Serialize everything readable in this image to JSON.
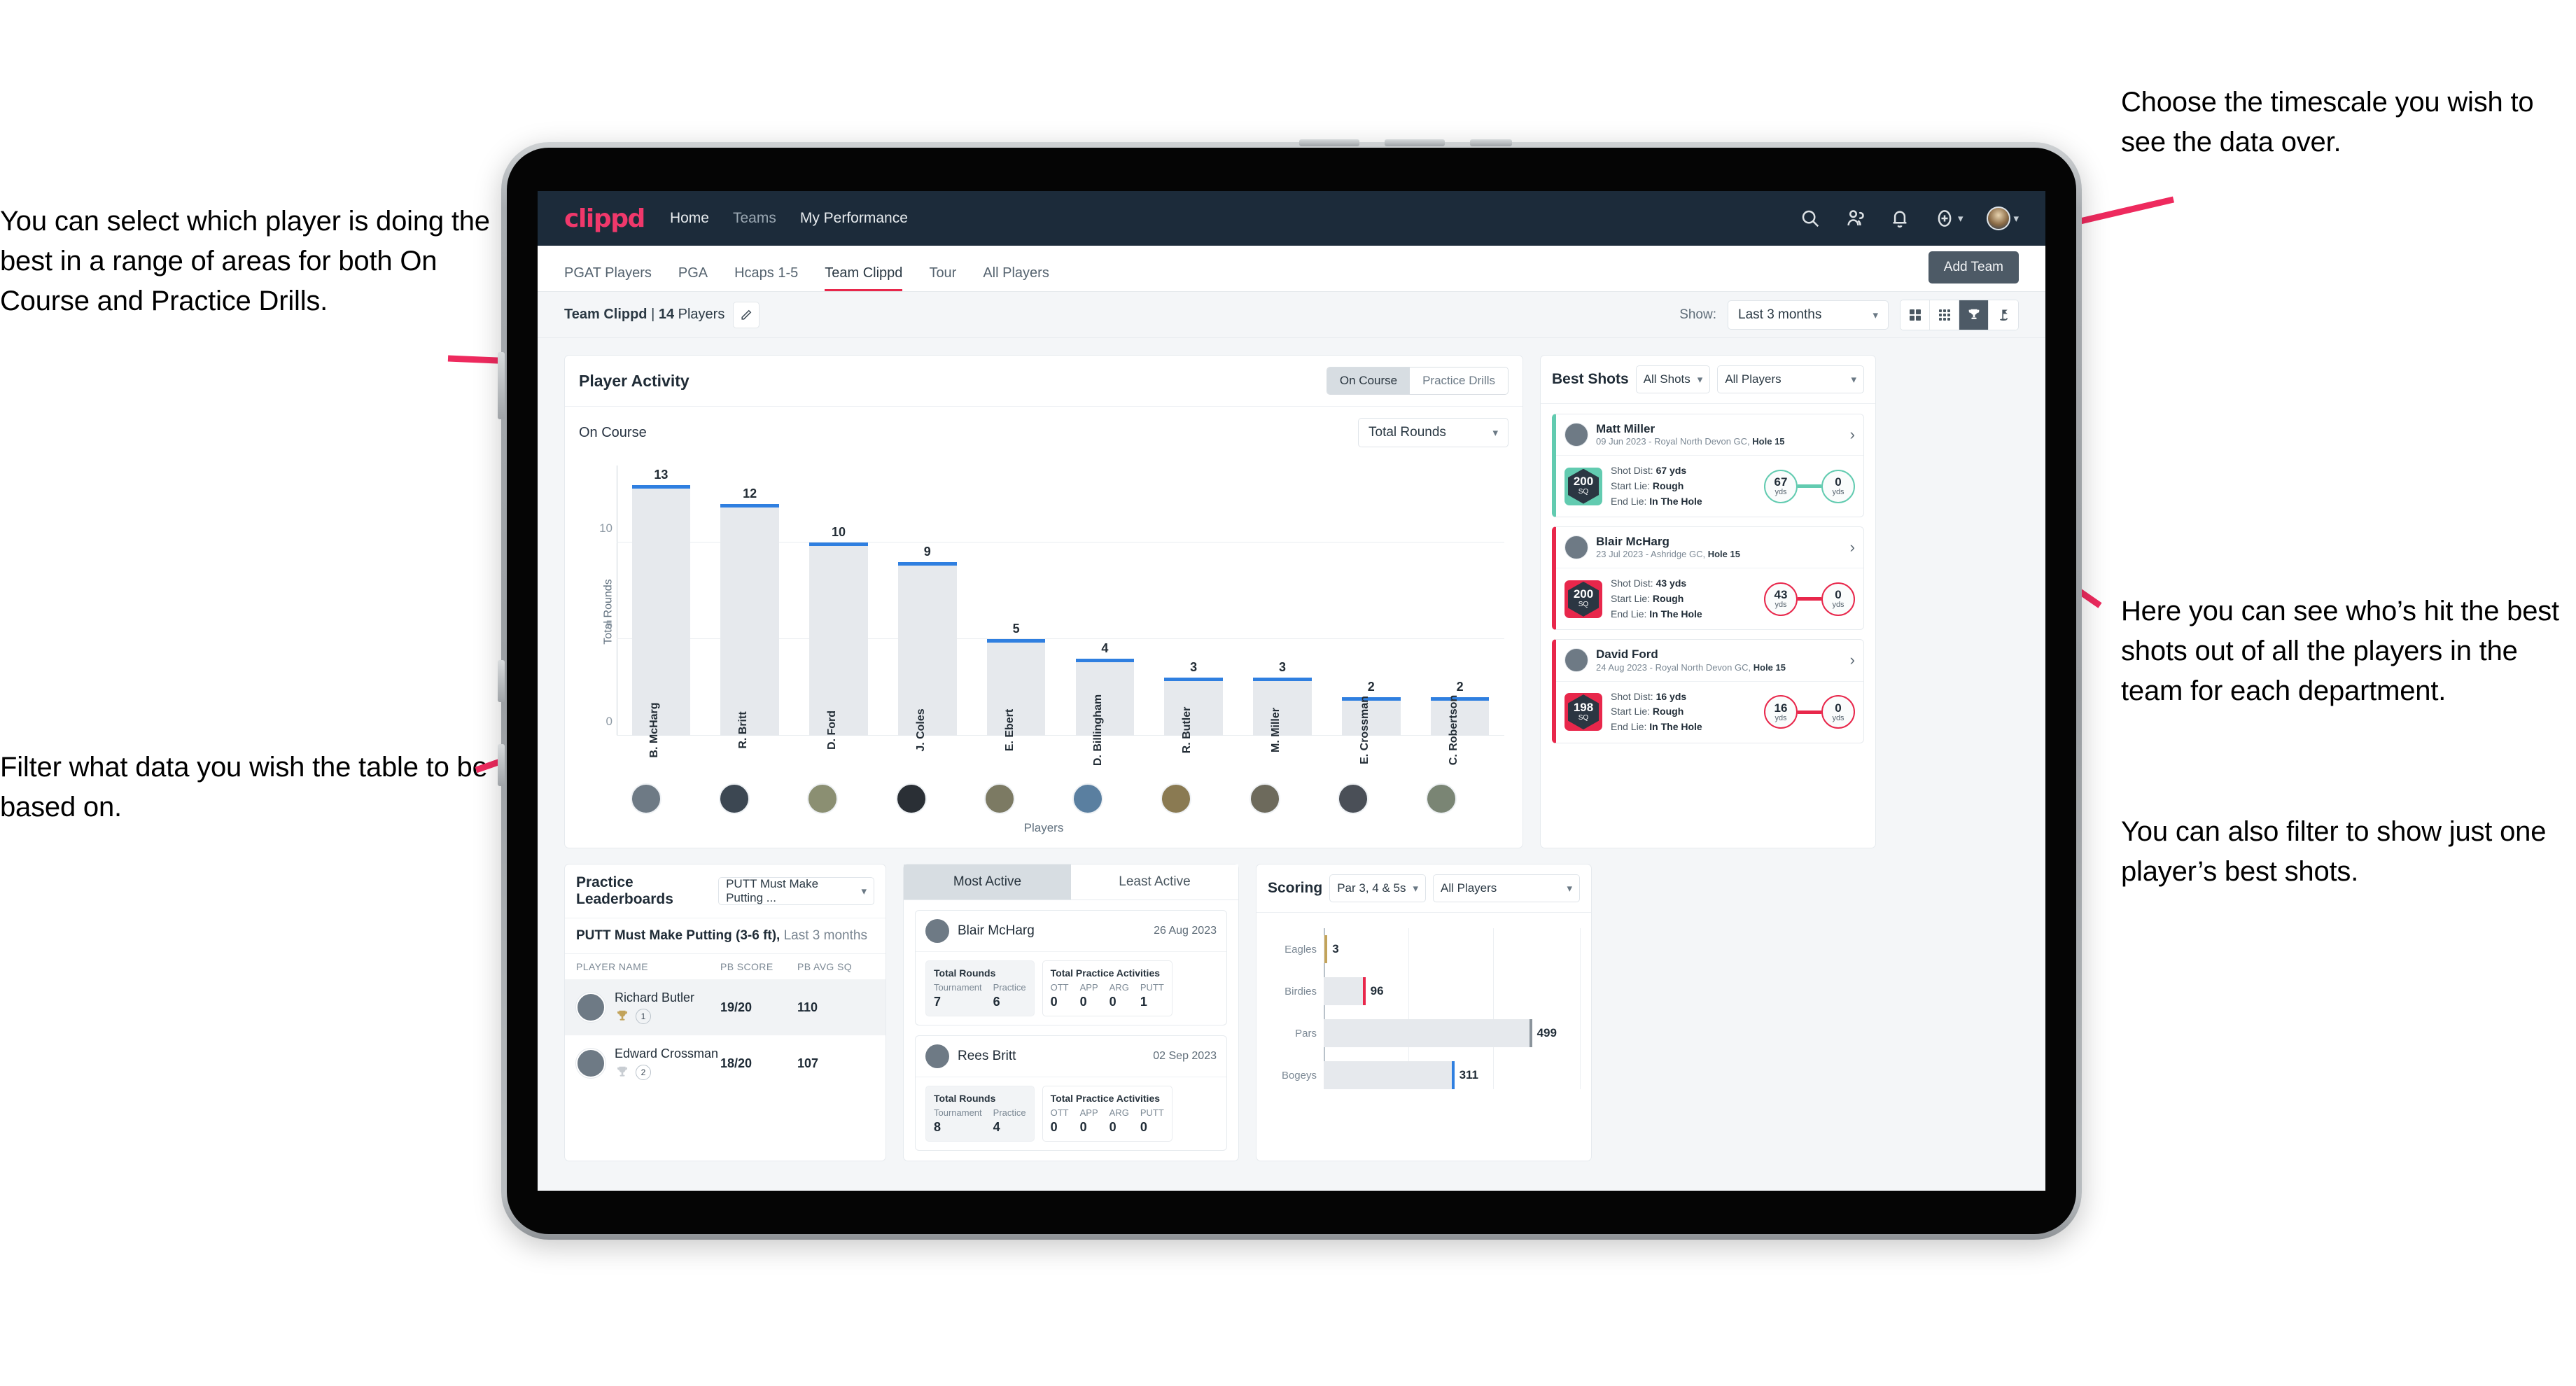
{
  "annotations": {
    "left_top": "You can select which player is doing the best in a range of areas for both On Course and Practice Drills.",
    "left_bottom": "Filter what data you wish the table to be based on.",
    "right_top": "Choose the timescale you wish to see the data over.",
    "right_middle": "Here you can see who’s hit the best shots out of all the players in the team for each department.",
    "right_bottom": "You can also filter to show just one player’s best shots."
  },
  "colors": {
    "brand_pink": "#f0386b",
    "navy": "#1c2b3a",
    "accent_blue": "#2f7fe0",
    "teal": "#62cbb0",
    "crimson": "#e8274b",
    "gold": "#c2a35a"
  },
  "navbar": {
    "brand": "clippd",
    "links": [
      {
        "label": "Home"
      },
      {
        "label": "Teams"
      },
      {
        "label": "My Performance"
      }
    ],
    "icons": [
      "search-icon",
      "people-icon",
      "bell-icon",
      "plus-circle-icon",
      "avatar"
    ]
  },
  "tabs": {
    "items": [
      {
        "label": "PGAT Players",
        "active": false
      },
      {
        "label": "PGA",
        "active": false
      },
      {
        "label": "Hcaps 1-5",
        "active": false
      },
      {
        "label": "Team Clippd",
        "active": true
      },
      {
        "label": "Tour",
        "active": false
      },
      {
        "label": "All Players",
        "active": false
      }
    ],
    "add_team_label": "Add Team"
  },
  "subbar": {
    "team_name": "Team Clippd",
    "separator": " | ",
    "player_count": "14",
    "players_word": " Players",
    "show_label": "Show:",
    "timescale_value": "Last 3 months",
    "view_icons": [
      {
        "name": "grid-4-icon",
        "active": false
      },
      {
        "name": "grid-9-icon",
        "active": false
      },
      {
        "name": "trophy-icon",
        "active": true
      },
      {
        "name": "golf-flag-icon",
        "active": false
      }
    ]
  },
  "player_activity": {
    "title": "Player Activity",
    "segments": [
      {
        "label": "On Course",
        "active": true
      },
      {
        "label": "Practice Drills",
        "active": false
      }
    ],
    "sub_label": "On Course",
    "metric_value": "Total Rounds"
  },
  "chart_data": {
    "type": "bar",
    "title": "Player Activity",
    "xlabel": "Players",
    "ylabel": "Total Rounds",
    "ylim": [
      0,
      14
    ],
    "yticks": [
      "0",
      "5",
      "10"
    ],
    "grid": true,
    "categories": [
      "B. McHarg",
      "R. Britt",
      "D. Ford",
      "J. Coles",
      "E. Ebert",
      "D. Billingham",
      "R. Butler",
      "M. Miller",
      "E. Crossman",
      "C. Robertson"
    ],
    "values": [
      13,
      12,
      10,
      9,
      5,
      4,
      3,
      3,
      2,
      2
    ]
  },
  "best_shots": {
    "title": "Best Shots",
    "filter_shots": "All Shots",
    "filter_players": "All Players",
    "shots": [
      {
        "player": "Matt Miller",
        "meta_date": "09 Jun 2023 - Royal North Devon GC, ",
        "meta_hole": "Hole 15",
        "sq": "200",
        "sq_unit": "SQ",
        "accent": "#62cbb0",
        "shot_dist_label": "Shot Dist: ",
        "shot_dist": "67 yds",
        "start_lie_label": "Start Lie: ",
        "start_lie": "Rough",
        "end_lie_label": "End Lie: ",
        "end_lie": "In The Hole",
        "from_val": "67",
        "from_unit": "yds",
        "to_val": "0",
        "to_unit": "yds"
      },
      {
        "player": "Blair McHarg",
        "meta_date": "23 Jul 2023 - Ashridge GC, ",
        "meta_hole": "Hole 15",
        "sq": "200",
        "sq_unit": "SQ",
        "accent": "#e8274b",
        "shot_dist_label": "Shot Dist: ",
        "shot_dist": "43 yds",
        "start_lie_label": "Start Lie: ",
        "start_lie": "Rough",
        "end_lie_label": "End Lie: ",
        "end_lie": "In The Hole",
        "from_val": "43",
        "from_unit": "yds",
        "to_val": "0",
        "to_unit": "yds"
      },
      {
        "player": "David Ford",
        "meta_date": "24 Aug 2023 - Royal North Devon GC, ",
        "meta_hole": "Hole 15",
        "sq": "198",
        "sq_unit": "SQ",
        "accent": "#e8274b",
        "shot_dist_label": "Shot Dist: ",
        "shot_dist": "16 yds",
        "start_lie_label": "Start Lie: ",
        "start_lie": "Rough",
        "end_lie_label": "End Lie: ",
        "end_lie": "In The Hole",
        "from_val": "16",
        "from_unit": "yds",
        "to_val": "0",
        "to_unit": "yds"
      }
    ]
  },
  "practice_leaderboards": {
    "title": "Practice Leaderboards",
    "drill_value": "PUTT Must Make Putting ...",
    "subtitle_bold": "PUTT Must Make Putting (3-6 ft),",
    "subtitle_muted": " Last 3 months",
    "columns": [
      "PLAYER NAME",
      "PB SCORE",
      "PB AVG SQ"
    ],
    "rows": [
      {
        "name": "Richard Butler",
        "rank": "1",
        "trophy": "gold",
        "pb_score": "19/20",
        "pb_avg_sq": "110",
        "highlight": true
      },
      {
        "name": "Edward Crossman",
        "rank": "2",
        "trophy": "silver",
        "pb_score": "18/20",
        "pb_avg_sq": "107",
        "highlight": false
      }
    ]
  },
  "activity": {
    "tabs": [
      {
        "label": "Most Active",
        "active": true
      },
      {
        "label": "Least Active",
        "active": false
      }
    ],
    "items": [
      {
        "name": "Blair McHarg",
        "date": "26 Aug 2023",
        "rounds_title": "Total Rounds",
        "rounds": [
          {
            "key": "Tournament",
            "value": "7"
          },
          {
            "key": "Practice",
            "value": "6"
          }
        ],
        "practice_title": "Total Practice Activities",
        "practice": [
          {
            "key": "OTT",
            "value": "0"
          },
          {
            "key": "APP",
            "value": "0"
          },
          {
            "key": "ARG",
            "value": "0"
          },
          {
            "key": "PUTT",
            "value": "1"
          }
        ]
      },
      {
        "name": "Rees Britt",
        "date": "02 Sep 2023",
        "rounds_title": "Total Rounds",
        "rounds": [
          {
            "key": "Tournament",
            "value": "8"
          },
          {
            "key": "Practice",
            "value": "4"
          }
        ],
        "practice_title": "Total Practice Activities",
        "practice": [
          {
            "key": "OTT",
            "value": "0"
          },
          {
            "key": "APP",
            "value": "0"
          },
          {
            "key": "ARG",
            "value": "0"
          },
          {
            "key": "PUTT",
            "value": "0"
          }
        ]
      }
    ]
  },
  "scoring": {
    "title": "Scoring",
    "filter_par": "Par 3, 4 & 5s",
    "filter_players": "All Players",
    "chart": {
      "type": "bar",
      "orientation": "horizontal",
      "categories": [
        "Eagles",
        "Birdies",
        "Pars",
        "Bogeys"
      ],
      "values": [
        3,
        96,
        499,
        311
      ],
      "xlim": [
        0,
        620
      ],
      "colors": [
        "#c2a35a",
        "#e8274b",
        "#8b949c",
        "#2f7fe0"
      ],
      "grid": true
    }
  }
}
